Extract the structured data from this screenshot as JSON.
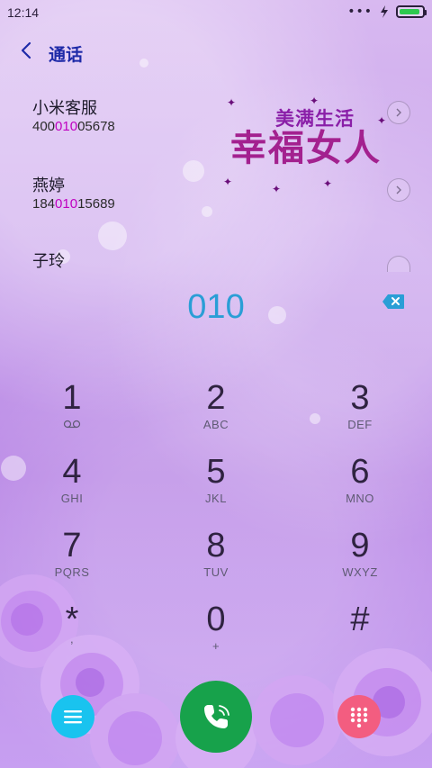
{
  "status": {
    "time": "12:14",
    "overflow_dots": "•••"
  },
  "header": {
    "title": "通话"
  },
  "contacts": [
    {
      "name": "小米客服",
      "number_pre": "400",
      "number_match": "010",
      "number_post": "05678"
    },
    {
      "name": "燕婷",
      "number_pre": "184",
      "number_match": "010",
      "number_post": "15689"
    },
    {
      "name": "子玲"
    }
  ],
  "watermark": {
    "line1": "美满生活",
    "line2": "幸福女人"
  },
  "dial": {
    "value": "010"
  },
  "keys": [
    {
      "digit": "1",
      "letters": ""
    },
    {
      "digit": "2",
      "letters": "ABC"
    },
    {
      "digit": "3",
      "letters": "DEF"
    },
    {
      "digit": "4",
      "letters": "GHI"
    },
    {
      "digit": "5",
      "letters": "JKL"
    },
    {
      "digit": "6",
      "letters": "MNO"
    },
    {
      "digit": "7",
      "letters": "PQRS"
    },
    {
      "digit": "8",
      "letters": "TUV"
    },
    {
      "digit": "9",
      "letters": "WXYZ"
    },
    {
      "digit": "*",
      "letters": ","
    },
    {
      "digit": "0",
      "letters": "+"
    },
    {
      "digit": "#",
      "letters": ""
    }
  ],
  "icons": {
    "back": "chevron-left-icon",
    "contact_detail": "chevron-right-circle-icon",
    "backspace": "backspace-icon",
    "voicemail": "voicemail-icon",
    "menu": "menu-icon",
    "call": "phone-call-icon",
    "dialpad": "dialpad-icon"
  },
  "colors": {
    "accent": "#2a9ed6",
    "match_highlight": "#c000c0",
    "menu_button": "#19c3ef",
    "call_button": "#17a24b",
    "dialpad_button": "#f35d80"
  }
}
